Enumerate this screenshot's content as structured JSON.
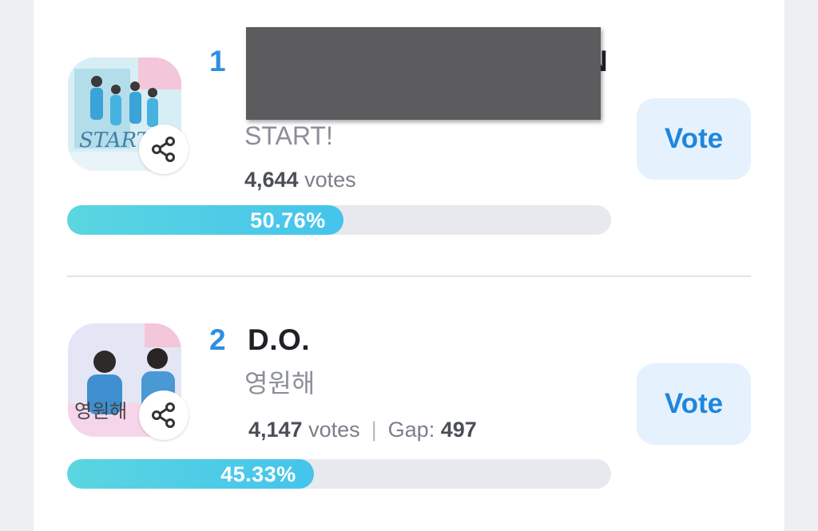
{
  "entries": [
    {
      "rank": "1",
      "artist": "N",
      "song": "START!",
      "votes_count": "4,644",
      "votes_word": "votes",
      "percent": "50.76%",
      "percent_value": 50.76,
      "vote_label": "Vote",
      "share_icon": "share-icon",
      "thumb_text": "START"
    },
    {
      "rank": "2",
      "artist": "D.O.",
      "song": "영원해",
      "votes_count": "4,147",
      "votes_word": "votes",
      "gap_label": "Gap:",
      "gap_value": "497",
      "percent": "45.33%",
      "percent_value": 45.33,
      "vote_label": "Vote",
      "share_icon": "share-icon",
      "thumb_text": "영원해"
    }
  ],
  "colors": {
    "accent": "#2e8fe0",
    "vote_button_bg": "#e5f2fd",
    "bar_fill": "#4fcfe6",
    "bar_track": "#e8e9ee"
  }
}
